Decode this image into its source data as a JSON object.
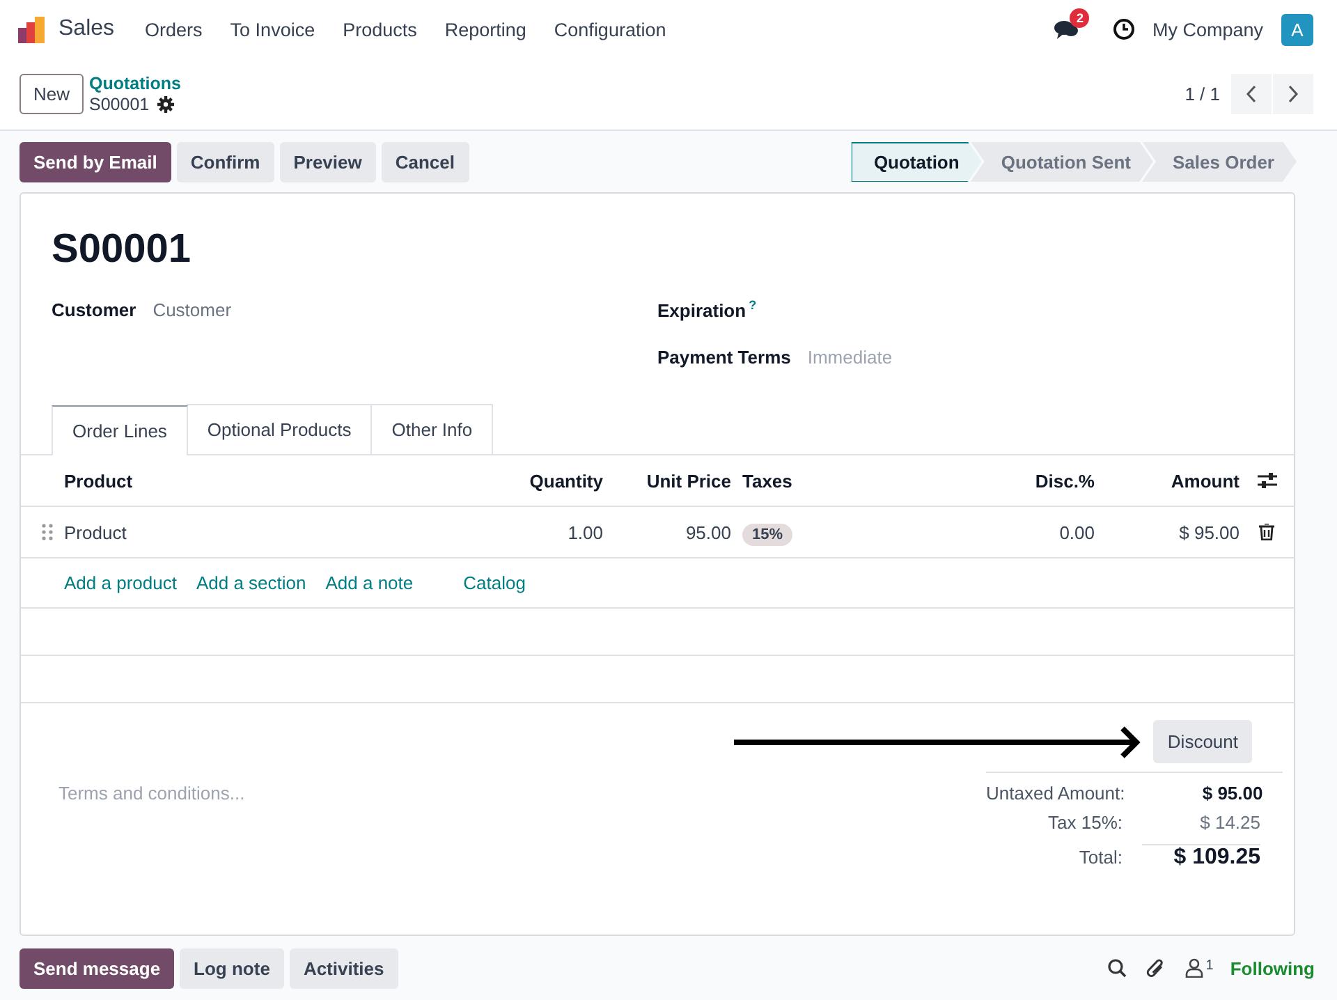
{
  "navbar": {
    "app": "Sales",
    "menu": [
      "Orders",
      "To Invoice",
      "Products",
      "Reporting",
      "Configuration"
    ],
    "messages_count": "2",
    "company": "My Company",
    "avatar": "A"
  },
  "control_panel": {
    "new_button": "New",
    "breadcrumb": "Quotations",
    "record": "S00001",
    "pager": "1 / 1"
  },
  "actions": [
    {
      "label": "Send by Email",
      "primary": true
    },
    {
      "label": "Confirm",
      "primary": false
    },
    {
      "label": "Preview",
      "primary": false
    },
    {
      "label": "Cancel",
      "primary": false
    }
  ],
  "stages": [
    {
      "label": "Quotation",
      "selected": true
    },
    {
      "label": "Quotation Sent",
      "selected": false
    },
    {
      "label": "Sales Order",
      "selected": false
    }
  ],
  "form": {
    "title": "S00001",
    "left_fields": [
      {
        "label": "Customer",
        "placeholder": "Customer"
      }
    ],
    "right_fields": [
      {
        "label": "Expiration",
        "help": "?"
      },
      {
        "label": "Payment Terms",
        "placeholder": "Immediate"
      }
    ]
  },
  "tabs": [
    {
      "label": "Order Lines",
      "selected": true
    },
    {
      "label": "Optional Products",
      "selected": false
    },
    {
      "label": "Other Info",
      "selected": false
    }
  ],
  "table": {
    "columns": [
      "Product",
      "Quantity",
      "Unit Price",
      "Taxes",
      "Disc.%",
      "Amount"
    ],
    "rows": [
      {
        "product": "Product",
        "quantity": "1.00",
        "unit_price": "95.00",
        "taxes": [
          "15%"
        ],
        "discount": "0.00",
        "amount": "$ 95.00"
      }
    ],
    "add_links": [
      "Add a product",
      "Add a section",
      "Add a note",
      "Catalog"
    ]
  },
  "terms_placeholder": "Terms and conditions...",
  "discount_button": "Discount",
  "totals": [
    {
      "label": "Untaxed Amount:",
      "value": "$ 95.00",
      "kind": "subtotal"
    },
    {
      "label": "Tax 15%:",
      "value": "$ 14.25",
      "kind": "tax"
    },
    {
      "label": "Total:",
      "value": "$ 109.25",
      "kind": "total"
    }
  ],
  "chatter": {
    "buttons": [
      {
        "label": "Send message",
        "primary": true
      },
      {
        "label": "Log note",
        "primary": false
      },
      {
        "label": "Activities",
        "primary": false
      }
    ],
    "followers_count": "1",
    "follow_label": "Following"
  }
}
